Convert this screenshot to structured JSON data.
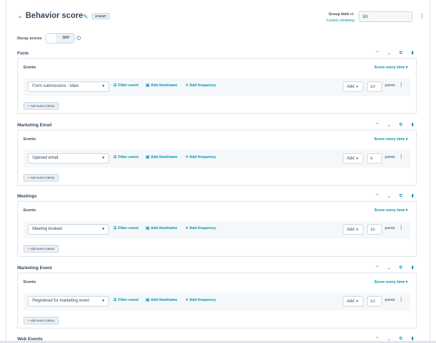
{
  "header": {
    "title": "Behavior score",
    "badge": "EVENT",
    "group_limit_label": "Group limit +/-",
    "group_limit_sub": "0 points remaining",
    "group_limit_value": "50"
  },
  "decay": {
    "label": "Decay scores",
    "toggle_state": "OFF"
  },
  "common": {
    "events_label": "Events",
    "score_every": "Score every time",
    "filter_event": "Filter event",
    "add_timeframe": "Add timeframe",
    "add_frequency": "Add frequency",
    "add_label": "Add",
    "points_label": "points",
    "add_criteria": "+ Add event criteria"
  },
  "sections": [
    {
      "title": "Form",
      "event": "Form submissions - Main",
      "points": "10"
    },
    {
      "title": "Marketing Email",
      "event": "Opened email",
      "points": "5"
    },
    {
      "title": "Meetings",
      "event": "Meeting booked",
      "points": "15"
    },
    {
      "title": "Marketing Event",
      "event": "Registered for marketing event",
      "points": "10"
    },
    {
      "title": "Web Events"
    }
  ],
  "icons": {
    "chevron": "chevron-down-icon",
    "edit": "pencil-icon",
    "kebab": "kebab-menu-icon",
    "info": "info-icon",
    "move_up": "chevron-up-icon",
    "move_down": "chevron-down-icon",
    "clone": "clone-icon",
    "delete": "trash-icon",
    "filter": "filter-icon",
    "calendar": "calendar-icon",
    "frequency": "hash-icon"
  },
  "colors": {
    "accent": "#0091ae",
    "text": "#33475b",
    "border": "#cbd6e2",
    "row_bg": "#f5f8fa"
  }
}
